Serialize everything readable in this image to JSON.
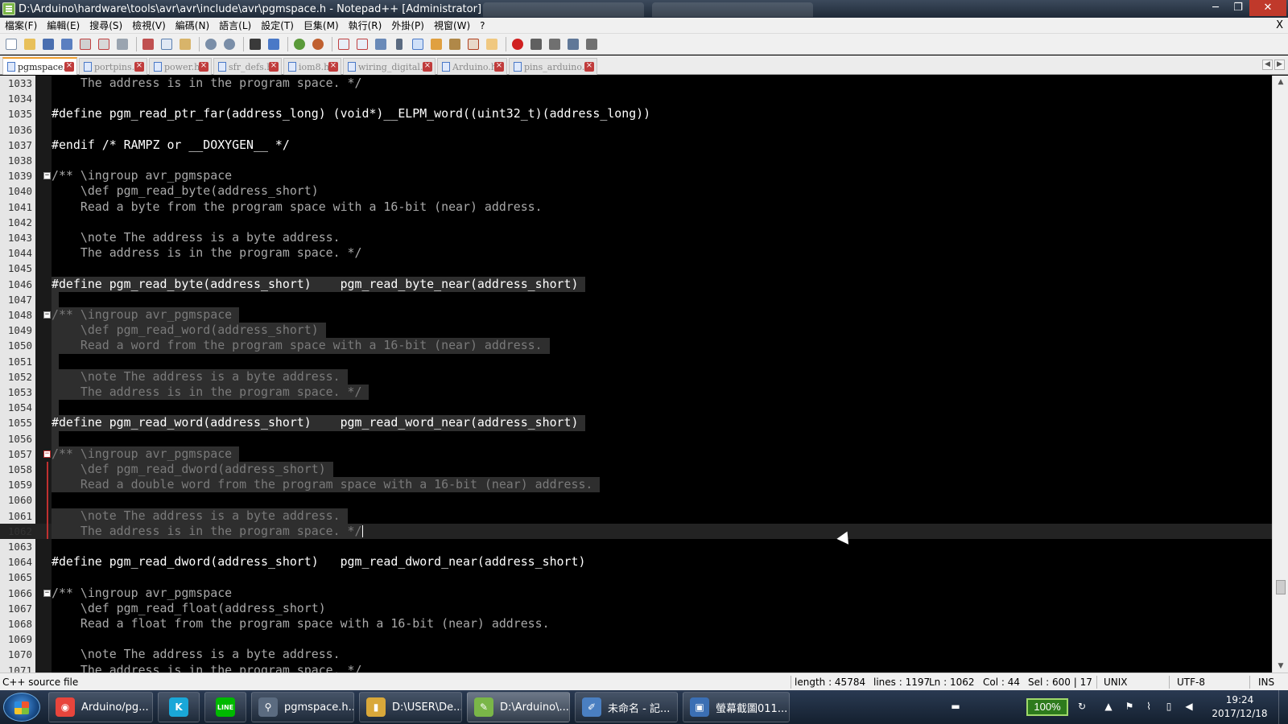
{
  "window": {
    "title": "D:\\Arduino\\hardware\\tools\\avr\\avr\\include\\avr\\pgmspace.h - Notepad++ [Administrator]",
    "minimize": "─",
    "maximize": "❐",
    "close": "✕"
  },
  "menu": {
    "items": [
      "檔案(F)",
      "編輯(E)",
      "搜尋(S)",
      "檢視(V)",
      "編碼(N)",
      "語言(L)",
      "設定(T)",
      "巨集(M)",
      "執行(R)",
      "外掛(P)",
      "視窗(W)",
      "?"
    ],
    "close_doc": "X"
  },
  "tabs": [
    {
      "label": "pgmspace.h",
      "active": true
    },
    {
      "label": "portpins.h",
      "active": false
    },
    {
      "label": "power.h",
      "active": false
    },
    {
      "label": "sfr_defs.h",
      "active": false
    },
    {
      "label": "iom8.h",
      "active": false
    },
    {
      "label": "wiring_digital.c",
      "active": false
    },
    {
      "label": "Arduino.h",
      "active": false
    },
    {
      "label": "pins_arduino.h",
      "active": false
    }
  ],
  "editor": {
    "lines": [
      {
        "n": "1033",
        "text": "    The address is in the program space. */",
        "kind": "comment"
      },
      {
        "n": "1034",
        "text": "",
        "kind": "plain"
      },
      {
        "n": "1035",
        "text": "#define pgm_read_ptr_far(address_long) (void*)__ELPM_word((uint32_t)(address_long))",
        "kind": "define"
      },
      {
        "n": "1036",
        "text": "",
        "kind": "plain"
      },
      {
        "n": "1037",
        "text": "#endif /* RAMPZ or __DOXYGEN__ */",
        "kind": "define"
      },
      {
        "n": "1038",
        "text": "",
        "kind": "plain"
      },
      {
        "n": "1039",
        "text": "/** \\ingroup avr_pgmspace",
        "kind": "comment",
        "fold": "minus"
      },
      {
        "n": "1040",
        "text": "    \\def pgm_read_byte(address_short)",
        "kind": "comment"
      },
      {
        "n": "1041",
        "text": "    Read a byte from the program space with a 16-bit (near) address.",
        "kind": "comment"
      },
      {
        "n": "1042",
        "text": "",
        "kind": "plain"
      },
      {
        "n": "1043",
        "text": "    \\note The address is a byte address.",
        "kind": "comment"
      },
      {
        "n": "1044",
        "text": "    The address is in the program space. */",
        "kind": "comment"
      },
      {
        "n": "1045",
        "text": "",
        "kind": "plain"
      },
      {
        "n": "1046",
        "text": "#define pgm_read_byte(address_short)    pgm_read_byte_near(address_short) ",
        "kind": "define-sel"
      },
      {
        "n": "1047",
        "text": " ",
        "kind": "sel-empty"
      },
      {
        "n": "1048",
        "text": "/** \\ingroup avr_pgmspace ",
        "kind": "comment-sel",
        "fold": "minus"
      },
      {
        "n": "1049",
        "text": "    \\def pgm_read_word(address_short) ",
        "kind": "comment-sel"
      },
      {
        "n": "1050",
        "text": "    Read a word from the program space with a 16-bit (near) address. ",
        "kind": "comment-sel"
      },
      {
        "n": "1051",
        "text": " ",
        "kind": "sel-empty"
      },
      {
        "n": "1052",
        "text": "    \\note The address is a byte address. ",
        "kind": "comment-sel"
      },
      {
        "n": "1053",
        "text": "    The address is in the program space. */ ",
        "kind": "comment-sel"
      },
      {
        "n": "1054",
        "text": " ",
        "kind": "sel-empty"
      },
      {
        "n": "1055",
        "text": "#define pgm_read_word(address_short)    pgm_read_word_near(address_short) ",
        "kind": "define-sel"
      },
      {
        "n": "1056",
        "text": " ",
        "kind": "sel-empty"
      },
      {
        "n": "1057",
        "text": "/** \\ingroup avr_pgmspace ",
        "kind": "comment-sel",
        "fold": "minus-red"
      },
      {
        "n": "1058",
        "text": "    \\def pgm_read_dword(address_short) ",
        "kind": "comment-sel",
        "foldbar": true
      },
      {
        "n": "1059",
        "text": "    Read a double word from the program space with a 16-bit (near) address. ",
        "kind": "comment-sel",
        "foldbar": true
      },
      {
        "n": "1060",
        "text": "",
        "kind": "plain",
        "foldbar": true
      },
      {
        "n": "1061",
        "text": "    \\note The address is a byte address. ",
        "kind": "comment-sel",
        "foldbar": true
      },
      {
        "n": "1062",
        "text": "    The address is in the program space. */",
        "kind": "comment-sel",
        "foldbar": true,
        "current": true
      },
      {
        "n": "1063",
        "text": "",
        "kind": "plain"
      },
      {
        "n": "1064",
        "text": "#define pgm_read_dword(address_short)   pgm_read_dword_near(address_short)",
        "kind": "define"
      },
      {
        "n": "1065",
        "text": "",
        "kind": "plain"
      },
      {
        "n": "1066",
        "text": "/** \\ingroup avr_pgmspace",
        "kind": "comment",
        "fold": "minus"
      },
      {
        "n": "1067",
        "text": "    \\def pgm_read_float(address_short)",
        "kind": "comment"
      },
      {
        "n": "1068",
        "text": "    Read a float from the program space with a 16-bit (near) address.",
        "kind": "comment"
      },
      {
        "n": "1069",
        "text": "",
        "kind": "plain"
      },
      {
        "n": "1070",
        "text": "    \\note The address is a byte address.",
        "kind": "comment"
      },
      {
        "n": "1071",
        "text": "    The address is in the program space. */",
        "kind": "comment"
      }
    ]
  },
  "status": {
    "file_type": "C++ source file",
    "length": "length : 45784",
    "lines": "lines : 1197",
    "ln": "Ln : 1062",
    "col": "Col : 44",
    "sel": "Sel : 600 | 17",
    "eol": "UNIX",
    "encoding": "UTF-8",
    "mode": "INS"
  },
  "taskbar": {
    "items": [
      {
        "label": "Arduino/pg...",
        "icon": "chrome-icon",
        "color": "#e8453c",
        "glyph": "◉"
      },
      {
        "label": "",
        "icon": "k-app-icon",
        "color": "#1aa7d8",
        "glyph": "K"
      },
      {
        "label": "",
        "icon": "line-app-icon",
        "color": "#00b900",
        "glyph": "LINE"
      },
      {
        "label": "pgmspace.h...",
        "icon": "search-icon",
        "color": "#5b6b80",
        "glyph": "🔍"
      },
      {
        "label": "D:\\USER\\De...",
        "icon": "folder-icon",
        "color": "#d9a83a",
        "glyph": "▮"
      },
      {
        "label": "D:\\Arduino\\...",
        "icon": "notepadpp-icon",
        "color": "#7ab648",
        "glyph": "✎"
      },
      {
        "label": "未命名 - 記...",
        "icon": "notepad-icon",
        "color": "#4a7fc1",
        "glyph": "✐"
      },
      {
        "label": "螢幕截圖011...",
        "icon": "screenshot-icon",
        "color": "#3b6fb4",
        "glyph": "▣"
      }
    ],
    "battery": "100%",
    "time": "19:24",
    "date": "2017/12/18"
  }
}
